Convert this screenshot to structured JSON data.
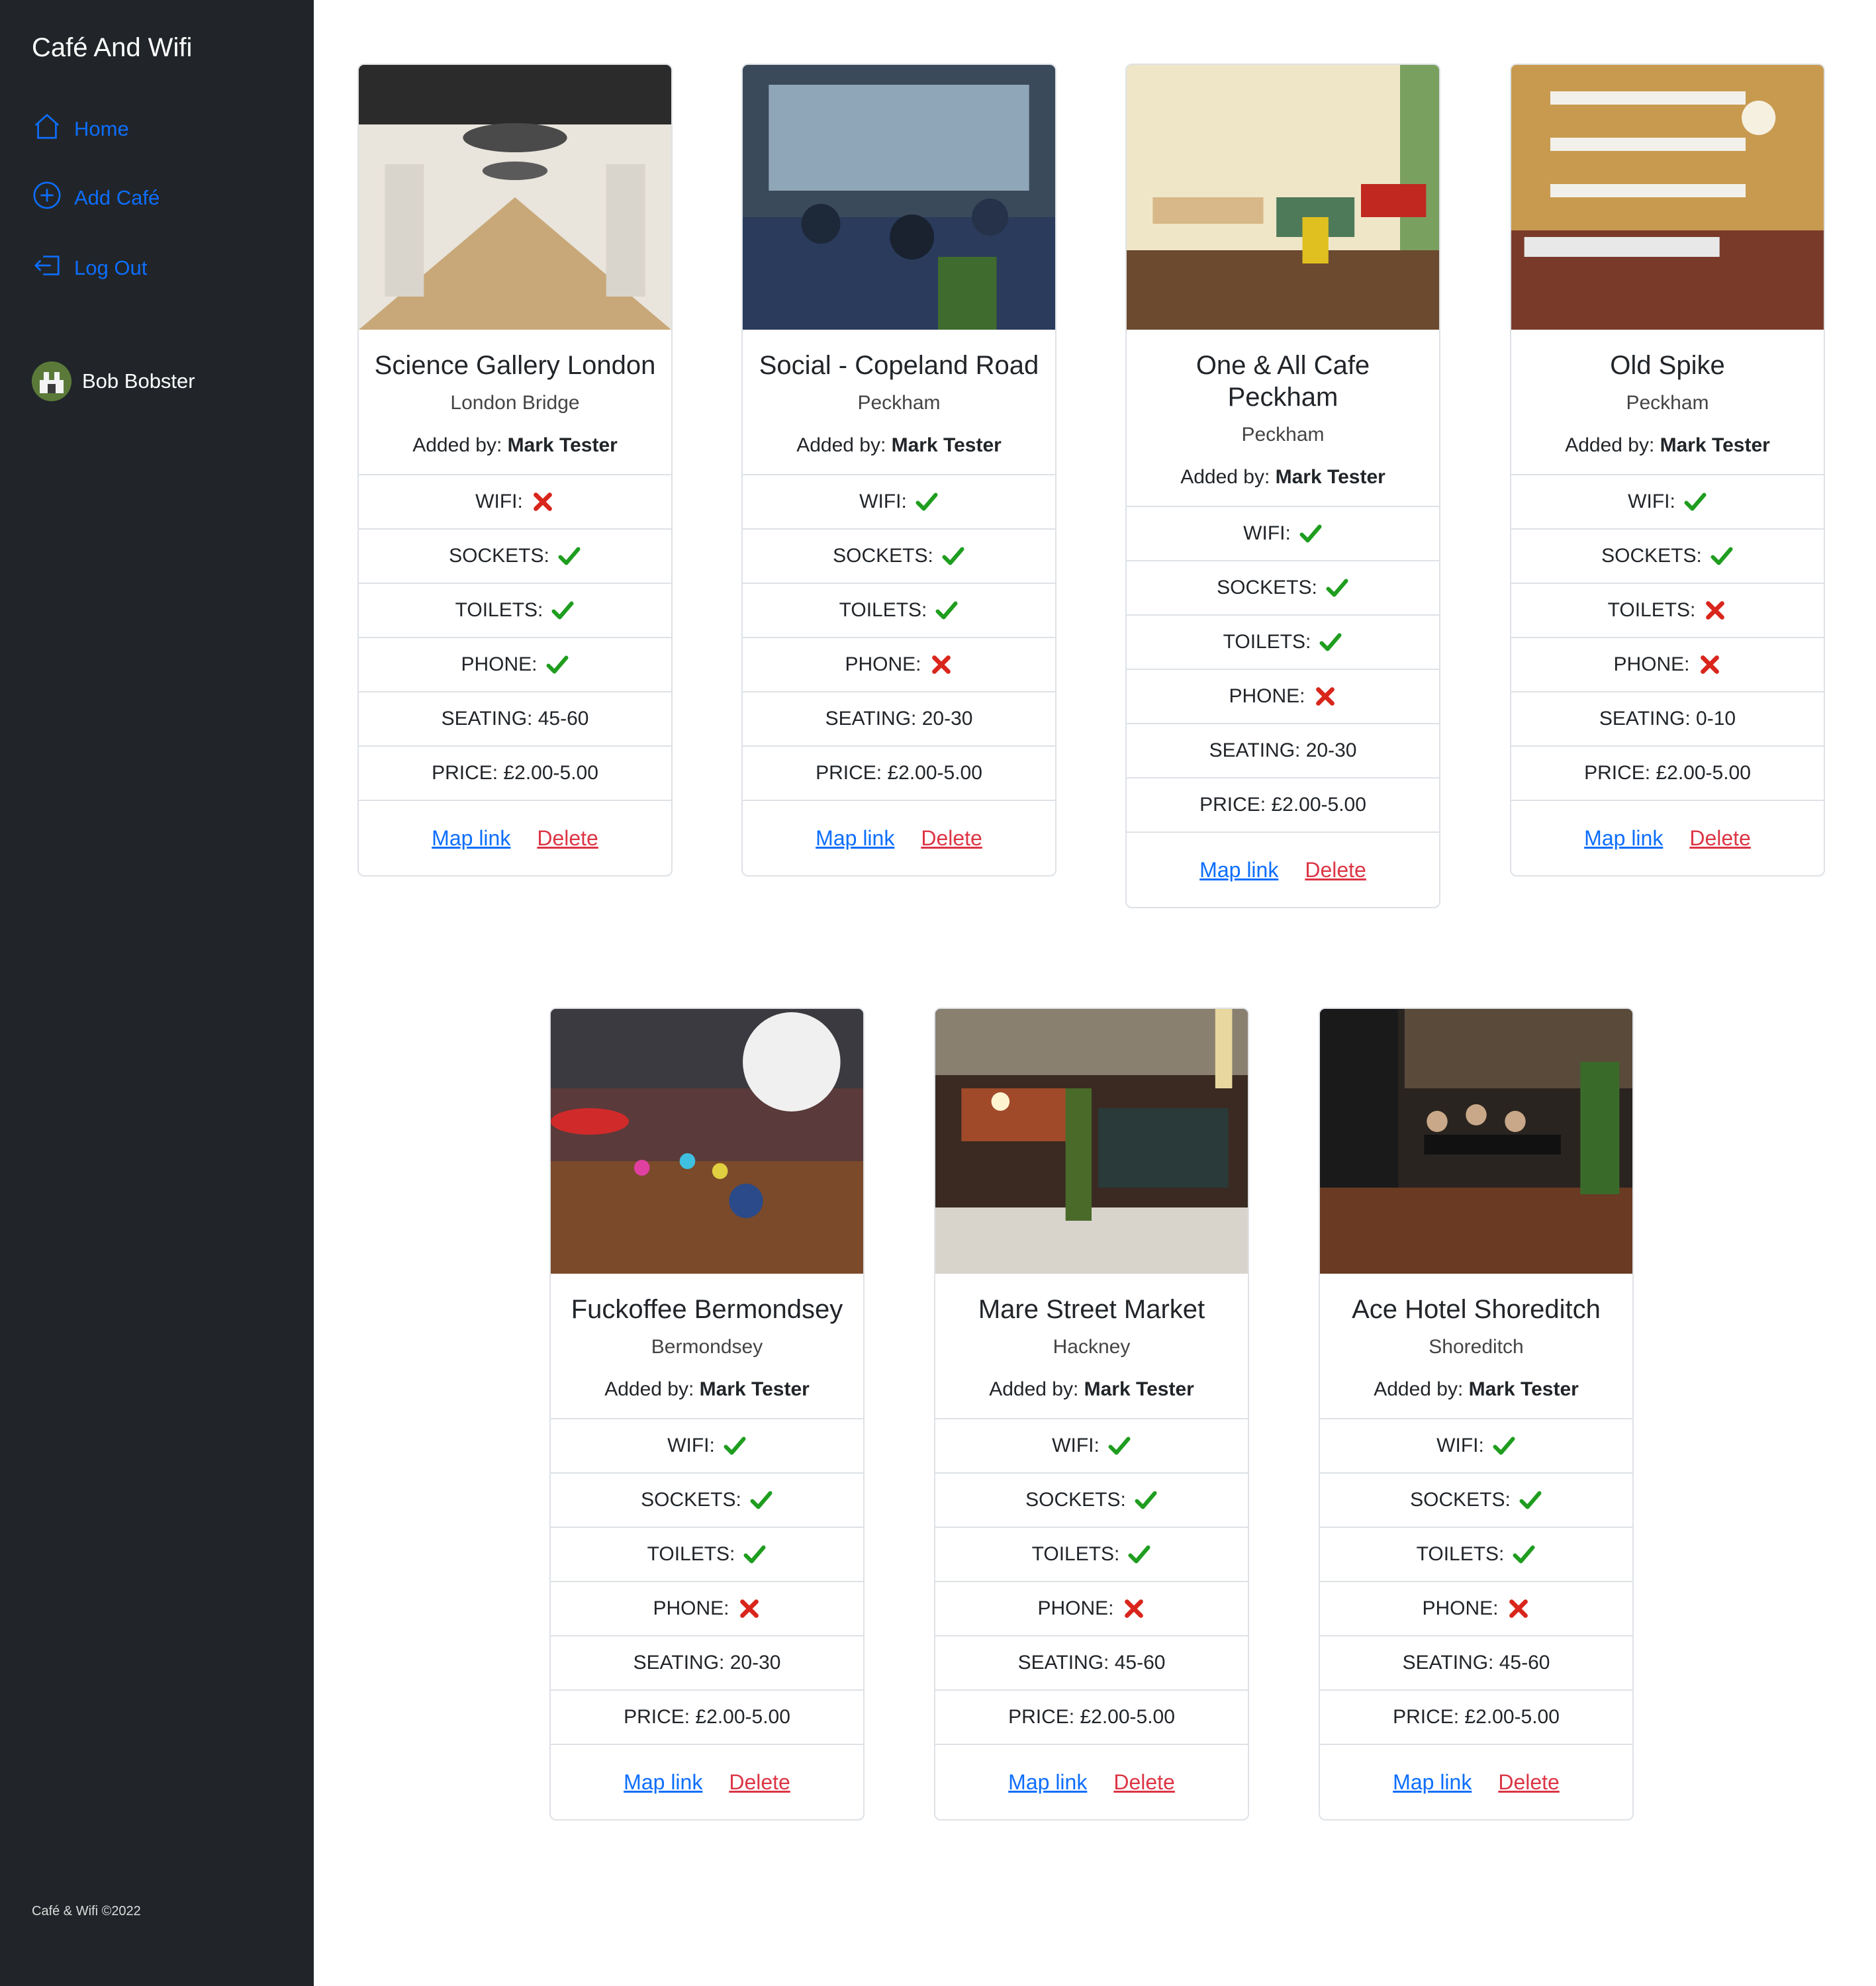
{
  "sidebar": {
    "brand": "Café And Wifi",
    "nav": [
      {
        "label": "Home",
        "icon": "house-icon"
      },
      {
        "label": "Add Café",
        "icon": "plus-circle-icon"
      },
      {
        "label": "Log Out",
        "icon": "box-arrow-left-icon"
      }
    ],
    "user": {
      "name": "Bob Bobster",
      "icon": "avatar-icon"
    },
    "footer": "Café & Wifi ©2022"
  },
  "labels": {
    "added_by": "Added by: ",
    "wifi": "WIFI:",
    "sockets": "SOCKETS:",
    "toilets": "TOILETS:",
    "phone": "PHONE:",
    "seating": "SEATING: ",
    "price": "PRICE: ",
    "map_link": "Map link",
    "delete": "Delete"
  },
  "colors": {
    "link": "#0d6efd",
    "delete": "#dc3545",
    "check": "#1f9d1f",
    "cross": "#d9261c",
    "sidebar": "#212529"
  },
  "cafes": [
    {
      "name": "Science Gallery London",
      "location": "London Bridge",
      "added_by": "Mark Tester",
      "wifi": false,
      "sockets": true,
      "toilets": true,
      "phone": true,
      "seating": "45-60",
      "price": "£2.00-5.00",
      "photo": "bright-long-cafe-hall"
    },
    {
      "name": "Social - Copeland Road",
      "location": "Peckham",
      "added_by": "Mark Tester",
      "wifi": true,
      "sockets": true,
      "toilets": true,
      "phone": false,
      "seating": "20-30",
      "price": "£2.00-5.00",
      "photo": "busy-cafe-interior"
    },
    {
      "name": "One & All Cafe Peckham",
      "location": "Peckham",
      "added_by": "Mark Tester",
      "wifi": true,
      "sockets": true,
      "toilets": true,
      "phone": false,
      "seating": "20-30",
      "price": "£2.00-5.00",
      "photo": "wooden-tables-cafe"
    },
    {
      "name": "Old Spike",
      "location": "Peckham",
      "added_by": "Mark Tester",
      "wifi": true,
      "sockets": true,
      "toilets": false,
      "phone": false,
      "seating": "0-10",
      "price": "£2.00-5.00",
      "photo": "coffee-bar-shelves"
    },
    {
      "name": "Fuckoffee Bermondsey",
      "location": "Bermondsey",
      "added_by": "Mark Tester",
      "wifi": true,
      "sockets": true,
      "toilets": true,
      "phone": false,
      "seating": "20-30",
      "price": "£2.00-5.00",
      "photo": "colorful-cafe-lamps"
    },
    {
      "name": "Mare Street Market",
      "location": "Hackney",
      "added_by": "Mark Tester",
      "wifi": true,
      "sockets": true,
      "toilets": true,
      "phone": false,
      "seating": "45-60",
      "price": "£2.00-5.00",
      "photo": "market-bar-interior"
    },
    {
      "name": "Ace Hotel Shoreditch",
      "location": "Shoreditch",
      "added_by": "Mark Tester",
      "wifi": true,
      "sockets": true,
      "toilets": true,
      "phone": false,
      "seating": "45-60",
      "price": "£2.00-5.00",
      "photo": "hotel-lobby-cafe"
    }
  ]
}
